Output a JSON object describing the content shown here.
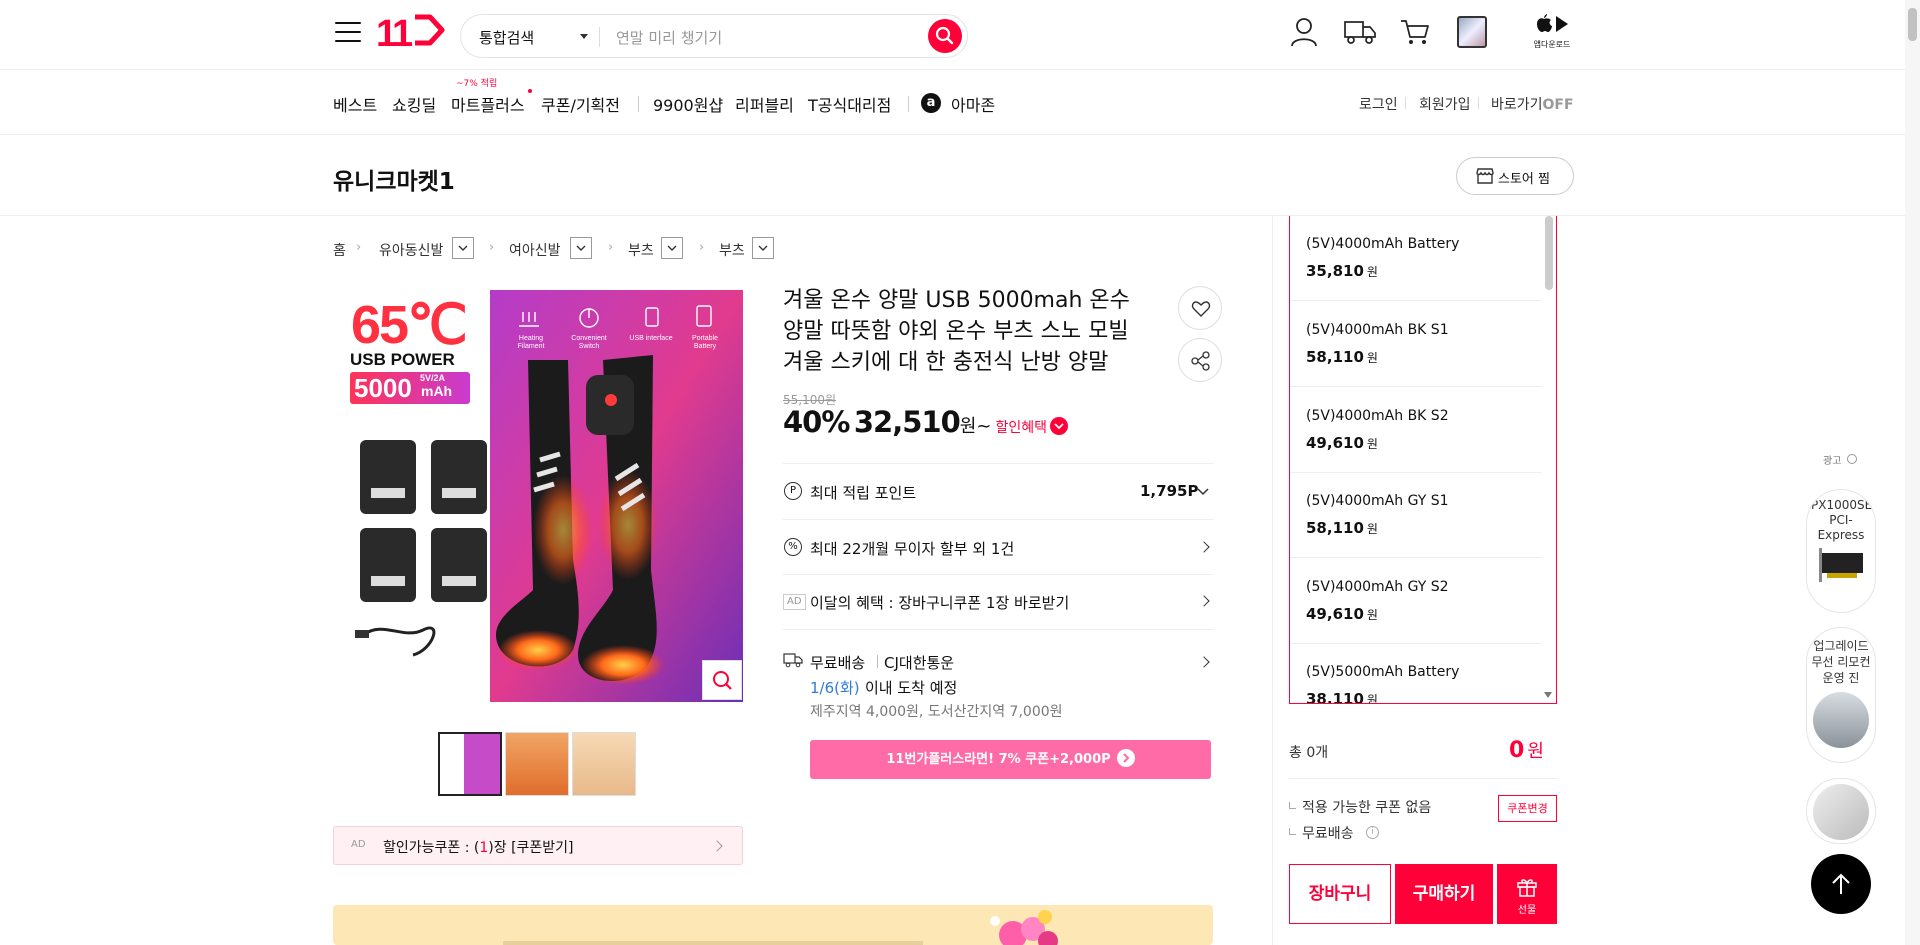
{
  "header": {
    "logo": "11",
    "search_category": "통합검색",
    "search_placeholder": "연말 미리 챙기기",
    "app_download": "앱다운로드"
  },
  "gnb": {
    "items": [
      "베스트",
      "쇼킹딜",
      "마트플러스",
      "쿠폰/기획전",
      "9900원샵",
      "리퍼블리",
      "T공식대리점",
      "아마존"
    ],
    "mart_badge": "~7% 적립",
    "util": {
      "login": "로그인",
      "join": "회원가입",
      "shortcut": "바로가기",
      "shortcut_state": "OFF"
    }
  },
  "store": {
    "name": "유니크마켓1",
    "follow_button": "스토어 찜"
  },
  "breadcrumb": [
    "홈",
    "유아동신발",
    "여아신발",
    "부츠",
    "부츠"
  ],
  "product_image": {
    "temp": "65℃",
    "usb_power": "USB POWER",
    "capacity": "5000",
    "capacity_unit": "mAh",
    "spec": "5V/2A",
    "features": [
      "Heating Filament",
      "Convenient Switch",
      "USB interface",
      "Portable Battery"
    ]
  },
  "product": {
    "title": "겨울 온수 양말 USB 5000mah 온수 양말 따뜻함 야외 온수 부츠 스노 모빌 겨울 스키에 대 한 충전식 난방 양말",
    "original_price": "55,100원",
    "discount": "40%",
    "price": "32,510",
    "price_unit": "원~",
    "benefit_label": "할인혜택",
    "point_label": "최대 적립 포인트",
    "point_value": "1,795P",
    "installment": "최대 22개월 무이자 할부 외 1건",
    "ad_tag": "AD",
    "monthly_benefit": "이달의 혜택 : 장바구니쿠폰 1장 바로받기",
    "shipping_free": "무료배송",
    "carrier": "CJ대한통운",
    "arrival_date": "1/6(화)",
    "arrival_text": "이내 도착 예정",
    "extra_fee": "제주지역 4,000원, 도서산간지역 7,000원",
    "plus_banner": "11번가플러스라면! 7% 쿠폰+2,000P",
    "coupon_prefix": "할인가능쿠폰 : (",
    "coupon_count": "1",
    "coupon_suffix": ")장 [쿠폰받기]"
  },
  "options": [
    {
      "name": "(5V)4000mAh Battery",
      "price": "35,810",
      "unit": "원"
    },
    {
      "name": "(5V)4000mAh BK S1",
      "price": "58,110",
      "unit": "원"
    },
    {
      "name": "(5V)4000mAh BK S2",
      "price": "49,610",
      "unit": "원"
    },
    {
      "name": "(5V)4000mAh GY S1",
      "price": "58,110",
      "unit": "원"
    },
    {
      "name": "(5V)4000mAh GY S2",
      "price": "49,610",
      "unit": "원"
    },
    {
      "name": "(5V)5000mAh Battery",
      "price": "38,110",
      "unit": "원"
    }
  ],
  "summary": {
    "total_label": "총 0개",
    "total_value": "0",
    "total_unit": "원",
    "no_coupon": "적용 가능한 쿠폰 없음",
    "coupon_change": "쿠폰변경",
    "free_shipping": "무료배송",
    "cart_button": "장바구니",
    "buy_button": "구매하기",
    "gift_button": "선물"
  },
  "side_ads": {
    "label": "광고",
    "items": [
      "PX1000SE PCI-Express",
      "업그레이드 무선 리모컨 운영 진"
    ]
  },
  "colors": {
    "brand": "#ff0038",
    "plus_pink": "#ff6ba6",
    "link_blue": "#2f7bd9"
  }
}
